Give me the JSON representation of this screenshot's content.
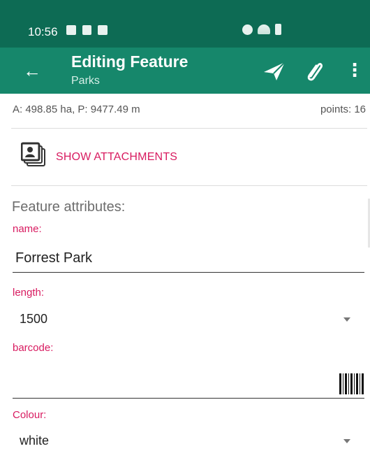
{
  "status_bar": {
    "time": "10:56",
    "icons": [
      "mail-icon",
      "facebook-icon",
      "storage-icon",
      "alarm-icon",
      "wifi-icon",
      "signal-icon",
      "battery-icon"
    ]
  },
  "app_bar": {
    "title": "Editing Feature",
    "subtitle": "Parks",
    "back_icon": "arrow-left-icon",
    "send_icon": "send-icon",
    "attach_icon": "paperclip-icon",
    "more_icon": "more-vert-icon",
    "back_glyph": "←",
    "more_glyph": "⋮"
  },
  "info": {
    "area_text": "A: 498.85 ha, P: 9477.49 m",
    "points_text": "points: 16"
  },
  "attachments": {
    "label": "SHOW ATTACHMENTS",
    "icon": "photo-gallery-icon"
  },
  "section_title": "Feature attributes:",
  "fields": {
    "name": {
      "label": "name:",
      "value": "Forrest Park"
    },
    "length": {
      "label": "length:",
      "value": "1500"
    },
    "barcode": {
      "label": "barcode:",
      "value": ""
    },
    "colour": {
      "label": "Colour:",
      "value": "white"
    }
  },
  "colors": {
    "status_bar": "#0d6b54",
    "app_bar": "#16876b",
    "accent": "#d81b60",
    "label_gray": "#6d6d6d"
  }
}
